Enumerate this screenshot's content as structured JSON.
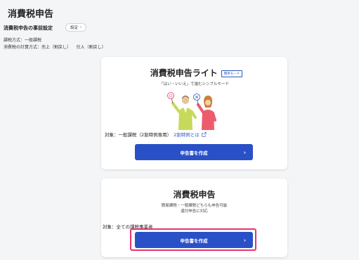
{
  "page": {
    "title": "消費税申告"
  },
  "settings": {
    "heading": "消費税申告の事前設定",
    "button_label": "設定",
    "taxation_line": "課税方式：一般課税",
    "calc_line": "消費税の計算方式：売上（割戻し）    仕入（割戻し）"
  },
  "lite_card": {
    "title": "消費税申告ライト",
    "badge": "簡単モード",
    "subtitle": "「はい・いいえ」で進むシンプルモード",
    "target_prefix": "対象：一般課税（2割特例専用）",
    "link_label": "2割特例とは",
    "button_label": "申告書を作成"
  },
  "full_card": {
    "title": "消費税申告",
    "desc_line1": "簡易課税・一般課税どちらも申告可能",
    "desc_line2": "還付申告に対応",
    "target": "対象：全ての課税事業者",
    "button_label": "申告書を作成"
  },
  "colors": {
    "primary": "#2a50c8",
    "highlight": "#e8336d",
    "link": "#2a55c0"
  },
  "icons": {
    "chevron": "chevron-right-icon",
    "external": "external-link-icon"
  }
}
